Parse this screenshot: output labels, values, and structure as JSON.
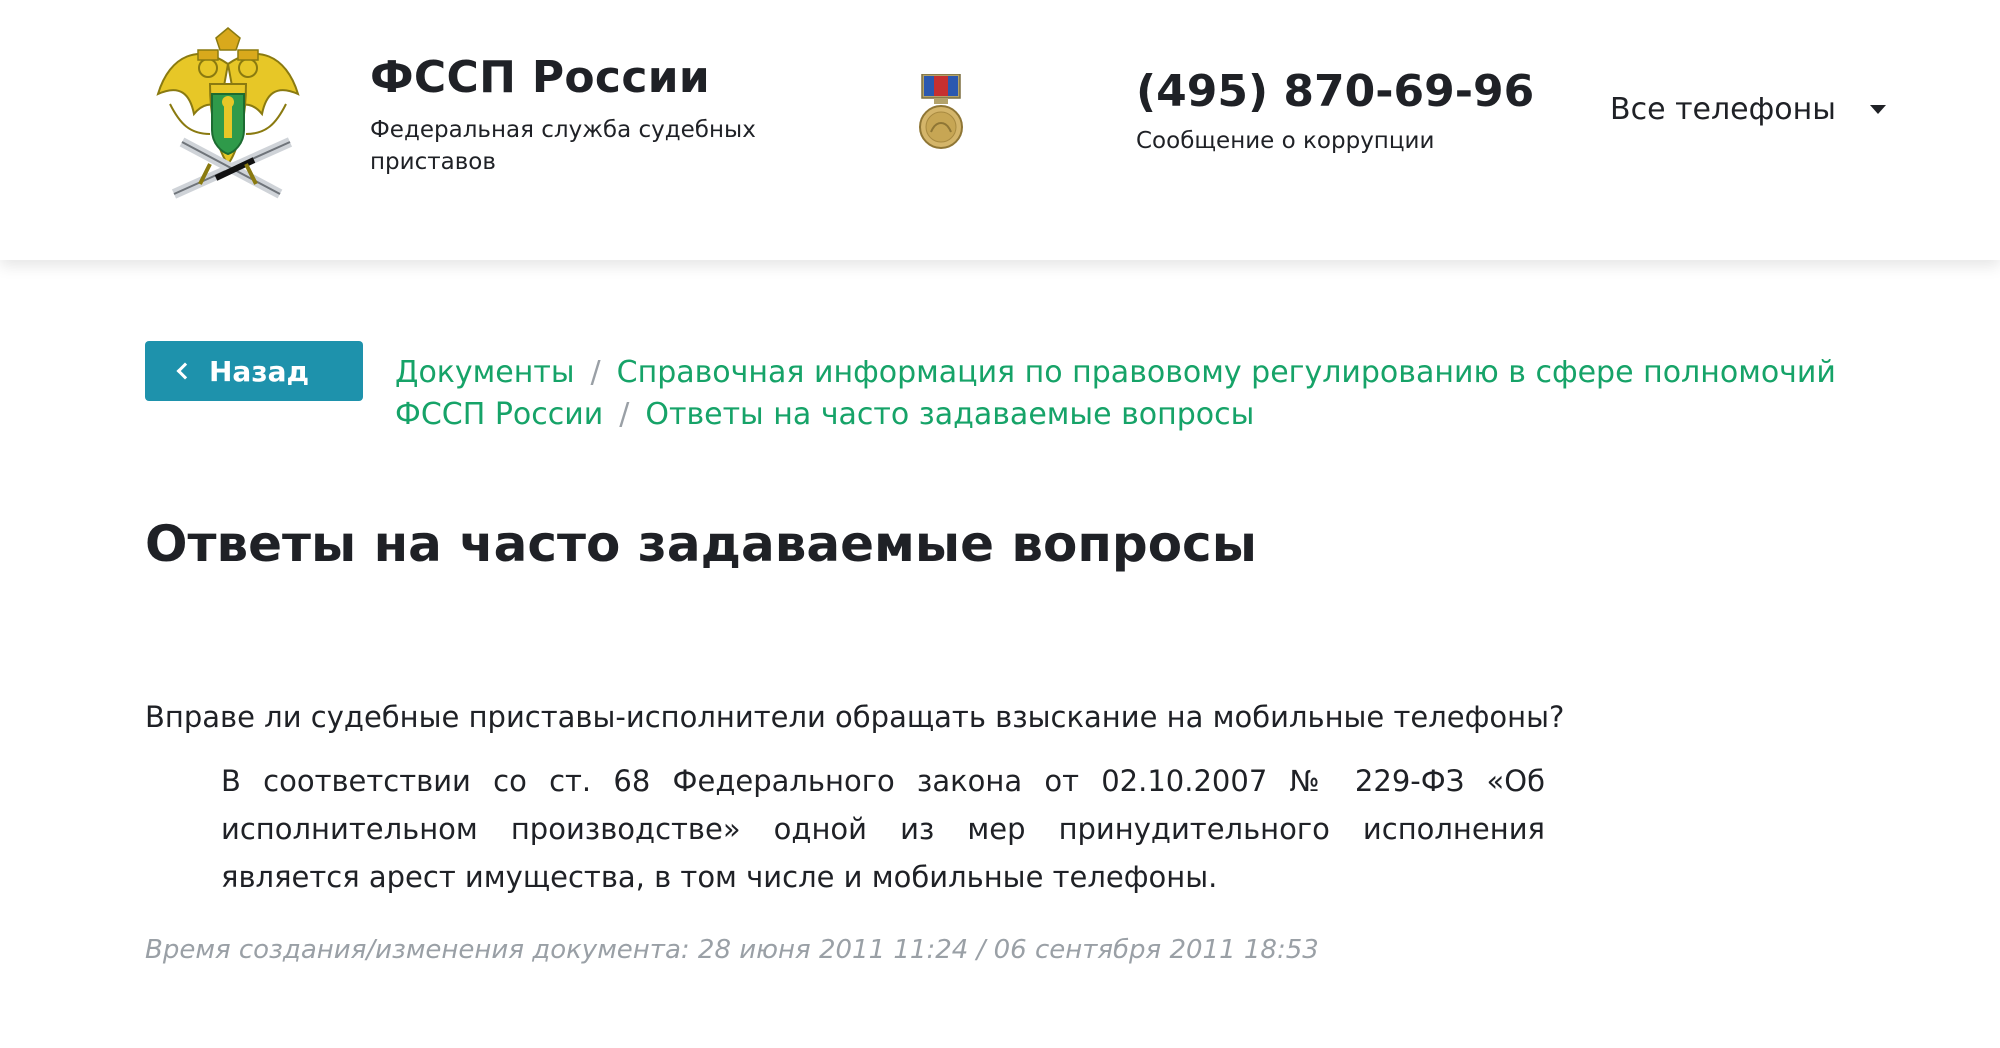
{
  "header": {
    "brand_title": "ФССП России",
    "brand_subtitle": "Федеральная служба судебных приставов",
    "phone_number": "(495) 870-69-96",
    "corruption_label": "Сообщение о коррупции",
    "all_phones_label": "Все телефоны"
  },
  "nav": {
    "back_label": "Назад"
  },
  "breadcrumb": {
    "items": [
      "Документы",
      "Справочная информация по правовому регулированию в сфере полномочий ФССП России",
      "Ответы на часто задаваемые вопросы"
    ]
  },
  "content": {
    "title": "Ответы на часто задаваемые вопросы",
    "question": "Вправе ли судебные приставы-исполнители обращать взыскание на мобильные телефоны?",
    "answer": "В соответствии со ст. 68 Федерального закона от 02.10.2007 №  229-ФЗ «Об исполнительном производстве» одной из мер принудительного исполнения является арест имущества, в том числе и мобильные телефоны.",
    "timestamp": "Время создания/изменения документа: 28 июня 2011 11:24 / 06 сентября 2011 18:53"
  },
  "icons": {
    "logo": "fssp-emblem-icon",
    "medal": "medal-icon",
    "all_phones_caret": "caret-down-icon",
    "back_chevron": "chevron-left-icon"
  },
  "colors": {
    "accent_button": "#1e92ac",
    "link_green": "#16a368",
    "muted_text": "#9aa0a6",
    "body_text": "#1f2126"
  }
}
